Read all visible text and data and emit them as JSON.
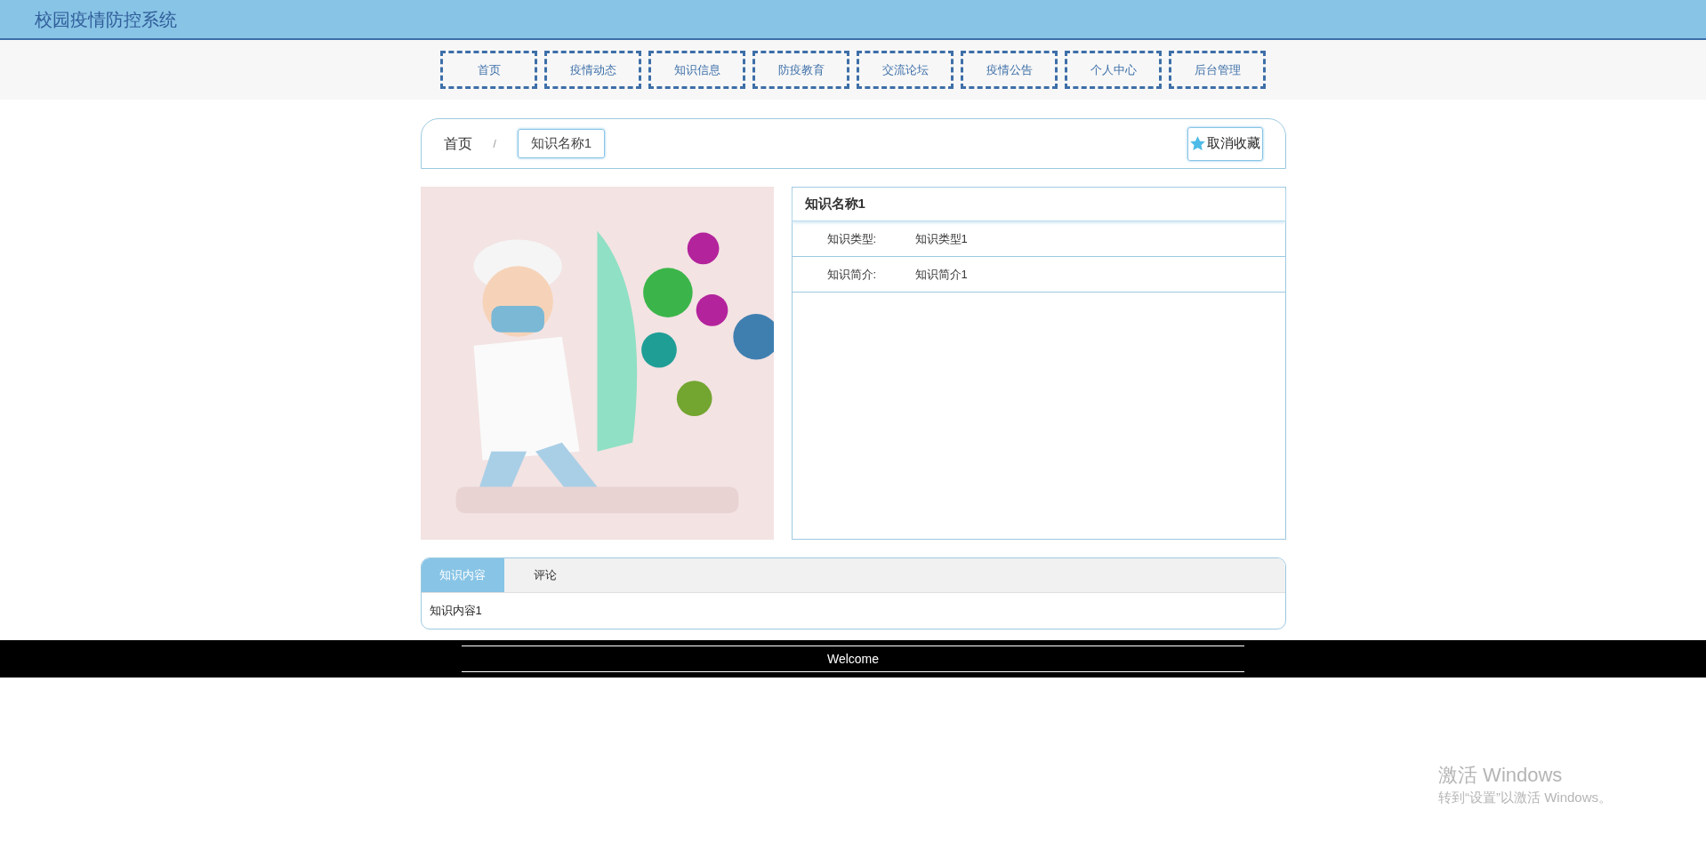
{
  "header": {
    "title": "校园疫情防控系统"
  },
  "nav": [
    {
      "label": "首页",
      "selected": false
    },
    {
      "label": "疫情动态",
      "selected": false
    },
    {
      "label": "知识信息",
      "selected": false
    },
    {
      "label": "防疫教育",
      "selected": false
    },
    {
      "label": "交流论坛",
      "selected": false
    },
    {
      "label": "疫情公告",
      "selected": false
    },
    {
      "label": "个人中心",
      "selected": false
    },
    {
      "label": "后台管理",
      "selected": false
    }
  ],
  "breadcrumb": {
    "home": "首页",
    "separator": "/",
    "current": "知识名称1"
  },
  "favorite_button": {
    "label": "取消收藏",
    "favorited": true
  },
  "detail": {
    "title": "知识名称1",
    "fields": [
      {
        "label": "知识类型:",
        "value": "知识类型1"
      },
      {
        "label": "知识简介:",
        "value": "知识简介1"
      }
    ]
  },
  "tabs": [
    {
      "label": "知识内容",
      "selected": true
    },
    {
      "label": "评论",
      "selected": false
    }
  ],
  "tab_content": "知识内容1",
  "footer": {
    "text": "Welcome"
  },
  "activation": {
    "title": "激活 Windows",
    "subtitle": "转到“设置”以激活 Windows。"
  }
}
